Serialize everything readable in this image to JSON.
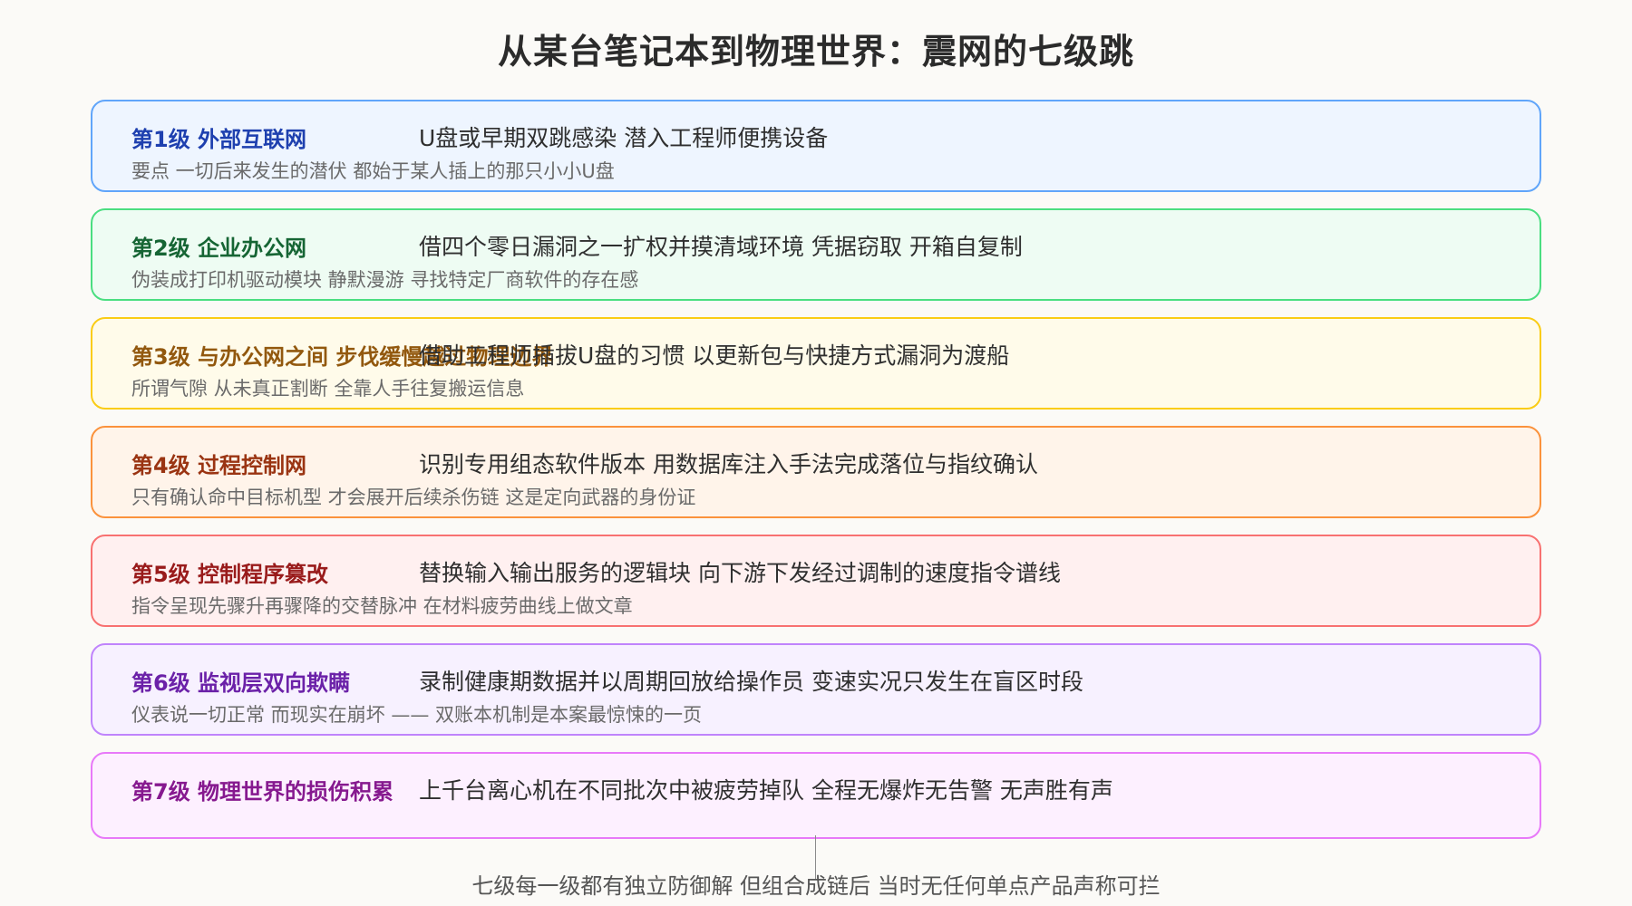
{
  "title": "从某台笔记本到物理世界：震网的七级跳",
  "stages": [
    {
      "title": "第1级 外部互联网",
      "desc": "U盘或早期双跳感染 潜入工程师便携设备",
      "note": "要点 一切后来发生的潜伏 都始于某人插上的那只小小U盘",
      "title_color": "#1e40af",
      "border_color": "#60a5fa",
      "bg_color": "#eef5ff"
    },
    {
      "title": "第2级 企业办公网",
      "desc": "借四个零日漏洞之一扩权并摸清域环境 凭据窃取 开箱自复制",
      "note": "伪装成打印机驱动模块 静默漫游 寻找特定厂商软件的存在感",
      "title_color": "#166534",
      "border_color": "#4ade80",
      "bg_color": "#eefcf3"
    },
    {
      "title": "第3级 与办公网之间 步伐缓慢越过物理边界",
      "desc": "借助工程师插拔U盘的习惯 以更新包与快捷方式漏洞为渡船",
      "note": "所谓气隙 从未真正割断 全靠人手往复搬运信息",
      "title_color": "#92580e",
      "border_color": "#facc15",
      "bg_color": "#fffbea"
    },
    {
      "title": "第4级 过程控制网",
      "desc": "识别专用组态软件版本 用数据库注入手法完成落位与指纹确认",
      "note": "只有确认命中目标机型 才会展开后续杀伤链 这是定向武器的身份证",
      "title_color": "#9a3412",
      "border_color": "#fb923c",
      "bg_color": "#fff4ea"
    },
    {
      "title": "第5级 控制程序篡改",
      "desc": "替换输入输出服务的逻辑块 向下游下发经过调制的速度指令谱线",
      "note": "指令呈现先骤升再骤降的交替脉冲 在材料疲劳曲线上做文章",
      "title_color": "#991b1b",
      "border_color": "#f87171",
      "bg_color": "#fff0f0"
    },
    {
      "title": "第6级 监视层双向欺瞒",
      "desc": "录制健康期数据并以周期回放给操作员 变速实况只发生在盲区时段",
      "note": "仪表说一切正常 而现实在崩坏 —— 双账本机制是本案最惊悚的一页",
      "title_color": "#6b21a8",
      "border_color": "#c084fc",
      "bg_color": "#f7f1ff"
    },
    {
      "title": "第7级 物理世界的损伤积累",
      "desc": "上千台离心机在不同批次中被疲劳掉队 全程无爆炸无告警 无声胜有声",
      "note": "",
      "title_color": "#86198f",
      "border_color": "#e879f9",
      "bg_color": "#fdf0ff"
    }
  ],
  "footer": "七级每一级都有独立防御解 但组合成链后 当时无任何单点产品声称可拦"
}
